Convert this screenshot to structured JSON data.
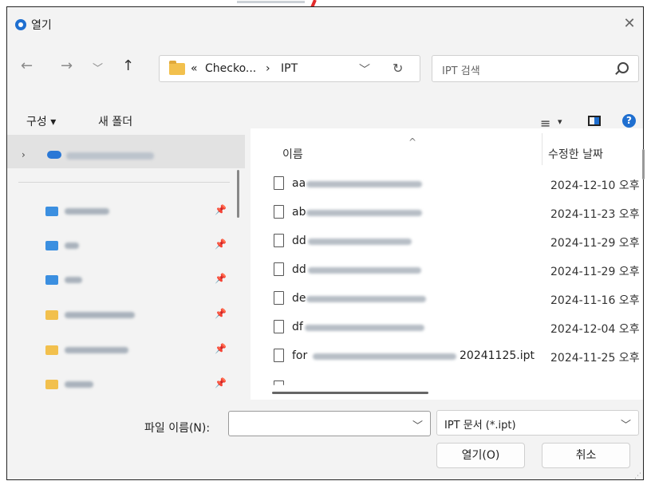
{
  "window": {
    "title": "열기",
    "close_glyph": "✕"
  },
  "nav": {
    "back_glyph": "←",
    "forward_glyph": "→",
    "recent_glyph": "﹀",
    "up_glyph": "↑",
    "crumb_overflow": "«",
    "crumbs": [
      "Checko...",
      "›",
      "IPT"
    ],
    "address_chevron": "﹀",
    "refresh_glyph": "↻"
  },
  "search": {
    "placeholder": "IPT 검색"
  },
  "commands": {
    "organize": "구성 ▾",
    "new_folder": "새 폴더",
    "view_glyph": "≡",
    "view_chevron": "▾",
    "help_glyph": "?"
  },
  "nav_pane": {
    "expand_glyph": "›",
    "pin_glyph": "📌"
  },
  "columns": {
    "name": "이름",
    "date": "수정한 날짜",
    "sort_glyph": "^"
  },
  "files": [
    {
      "prefix": "aa",
      "suffix": "",
      "date": "2024-12-10 오후"
    },
    {
      "prefix": "ab",
      "suffix": "",
      "date": "2024-11-23 오후"
    },
    {
      "prefix": "dd",
      "suffix": "",
      "date": "2024-11-29 오후"
    },
    {
      "prefix": "dd",
      "suffix": "",
      "date": "2024-11-29 오후"
    },
    {
      "prefix": "de",
      "suffix": "",
      "date": "2024-11-16 오후"
    },
    {
      "prefix": "df",
      "suffix": "",
      "date": "2024-12-04 오후"
    },
    {
      "prefix": "for",
      "suffix": "20241125.ipt",
      "date": "2024-11-25 오후"
    }
  ],
  "footer": {
    "filename_label": "파일 이름(N):",
    "filename_value": "",
    "dropdown_glyph": "﹀",
    "filter_value": "IPT 문서 (*.ipt)",
    "open_label": "열기(O)",
    "cancel_label": "취소",
    "grip_glyph": "⋰"
  },
  "colors": {
    "accent": "#1f6fd0",
    "folder": "#f2c04d",
    "selection": "#e2e2e2",
    "annotation": "#e22b2b"
  }
}
